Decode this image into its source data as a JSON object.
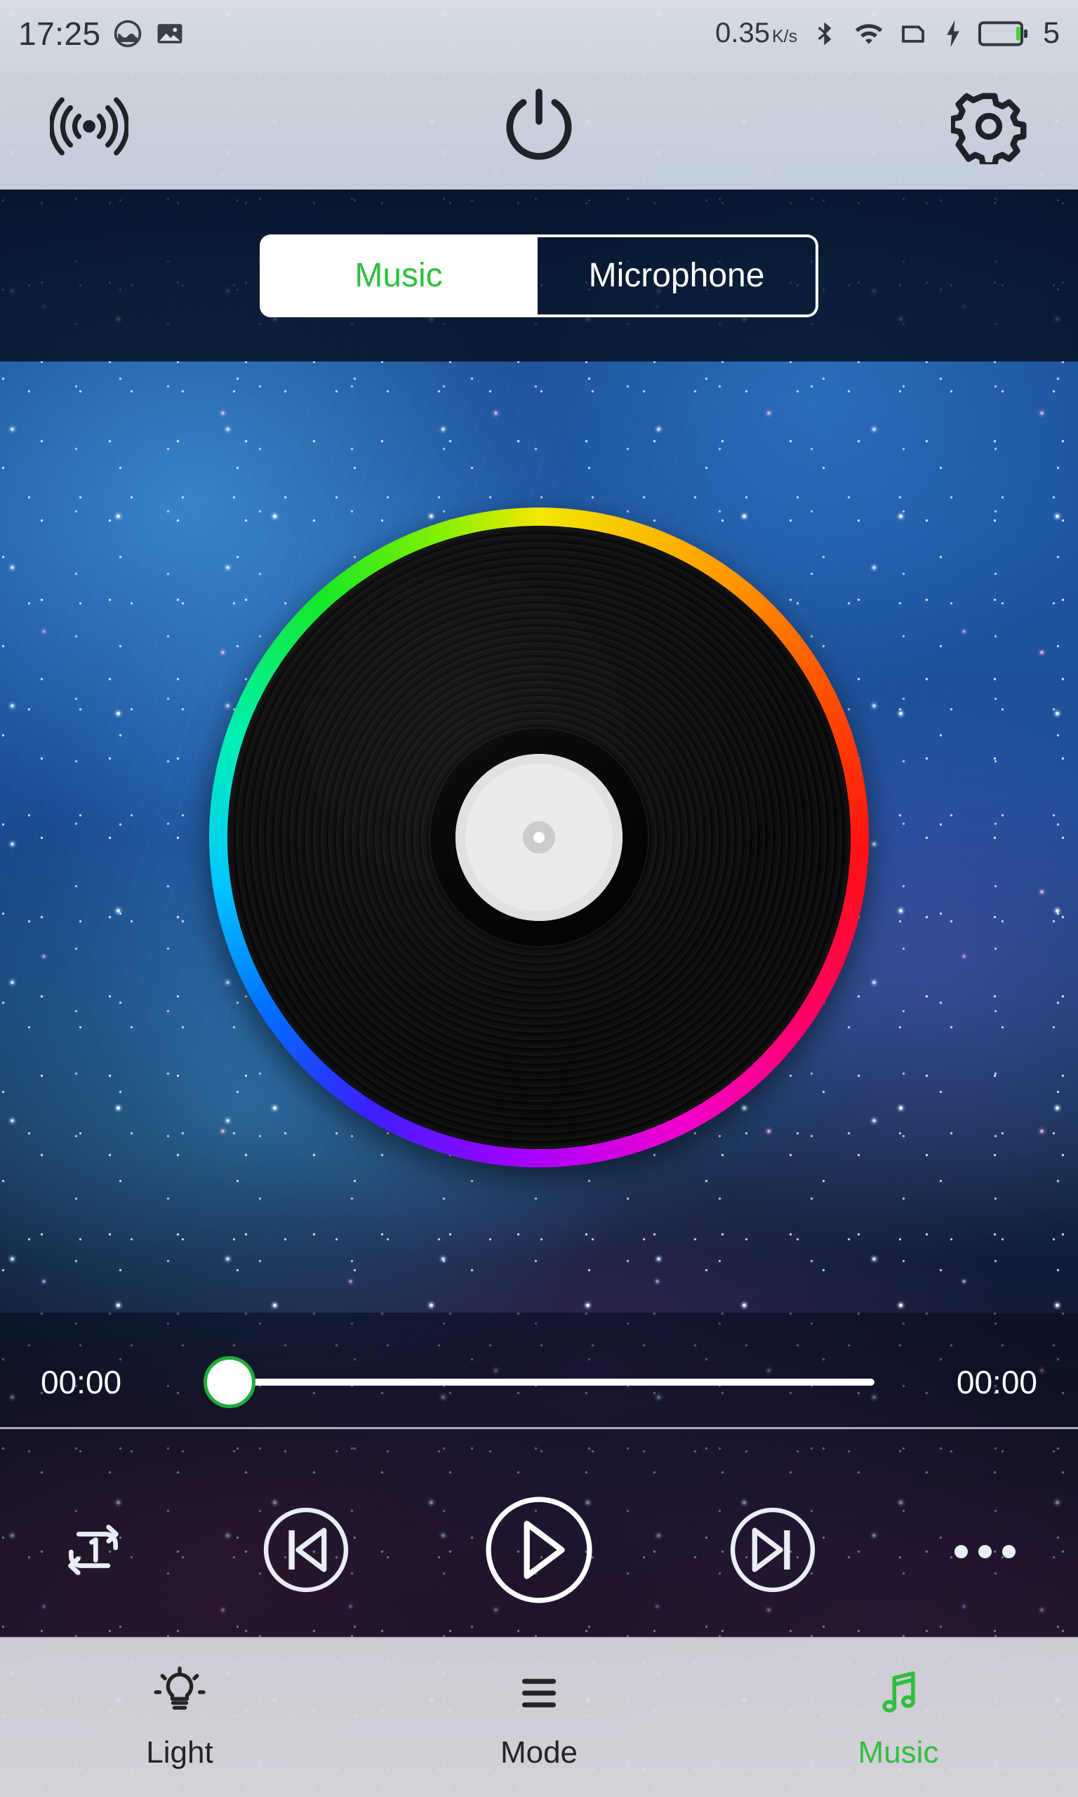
{
  "status_bar": {
    "time": "17:25",
    "network_speed": "0.35",
    "network_unit": "K/s",
    "battery_percent": "5",
    "icons": [
      "do-not-disturb-icon",
      "screenshot-image-icon",
      "bluetooth-icon",
      "wifi-icon",
      "sim-card-icon",
      "charging-bolt-icon",
      "battery-icon"
    ]
  },
  "toolbar": {
    "broadcast_label": "broadcast-icon",
    "power_label": "power-icon",
    "settings_label": "gear-icon"
  },
  "tabs": {
    "items": [
      {
        "label": "Music",
        "active": true
      },
      {
        "label": "Microphone",
        "active": false
      }
    ],
    "active_text_color": "#2fbf3f",
    "active_bg_color": "#ffffff",
    "inactive_text_color": "#ffffff"
  },
  "player": {
    "album_art": "vinyl-record",
    "ring_colors": [
      "#f2e800",
      "#ff9400",
      "#ff1212",
      "#f400c8",
      "#a800ff",
      "#0070ff",
      "#00c8ff",
      "#16e824"
    ],
    "elapsed_time": "00:00",
    "total_time": "00:00",
    "progress_percent": "0",
    "thumb_border_color": "#1fae3a"
  },
  "controls": {
    "repeat": "repeat-one-icon",
    "previous": "skip-previous-icon",
    "play": "play-icon",
    "next": "skip-next-icon",
    "more": "more-options-icon"
  },
  "bottom_nav": {
    "items": [
      {
        "label": "Light",
        "icon": "lightbulb-icon",
        "active": false
      },
      {
        "label": "Mode",
        "icon": "menu-lines-icon",
        "active": false
      },
      {
        "label": "Music",
        "icon": "music-note-icon",
        "active": true
      }
    ],
    "active_color": "#2fbf3f",
    "inactive_color": "#242424"
  }
}
